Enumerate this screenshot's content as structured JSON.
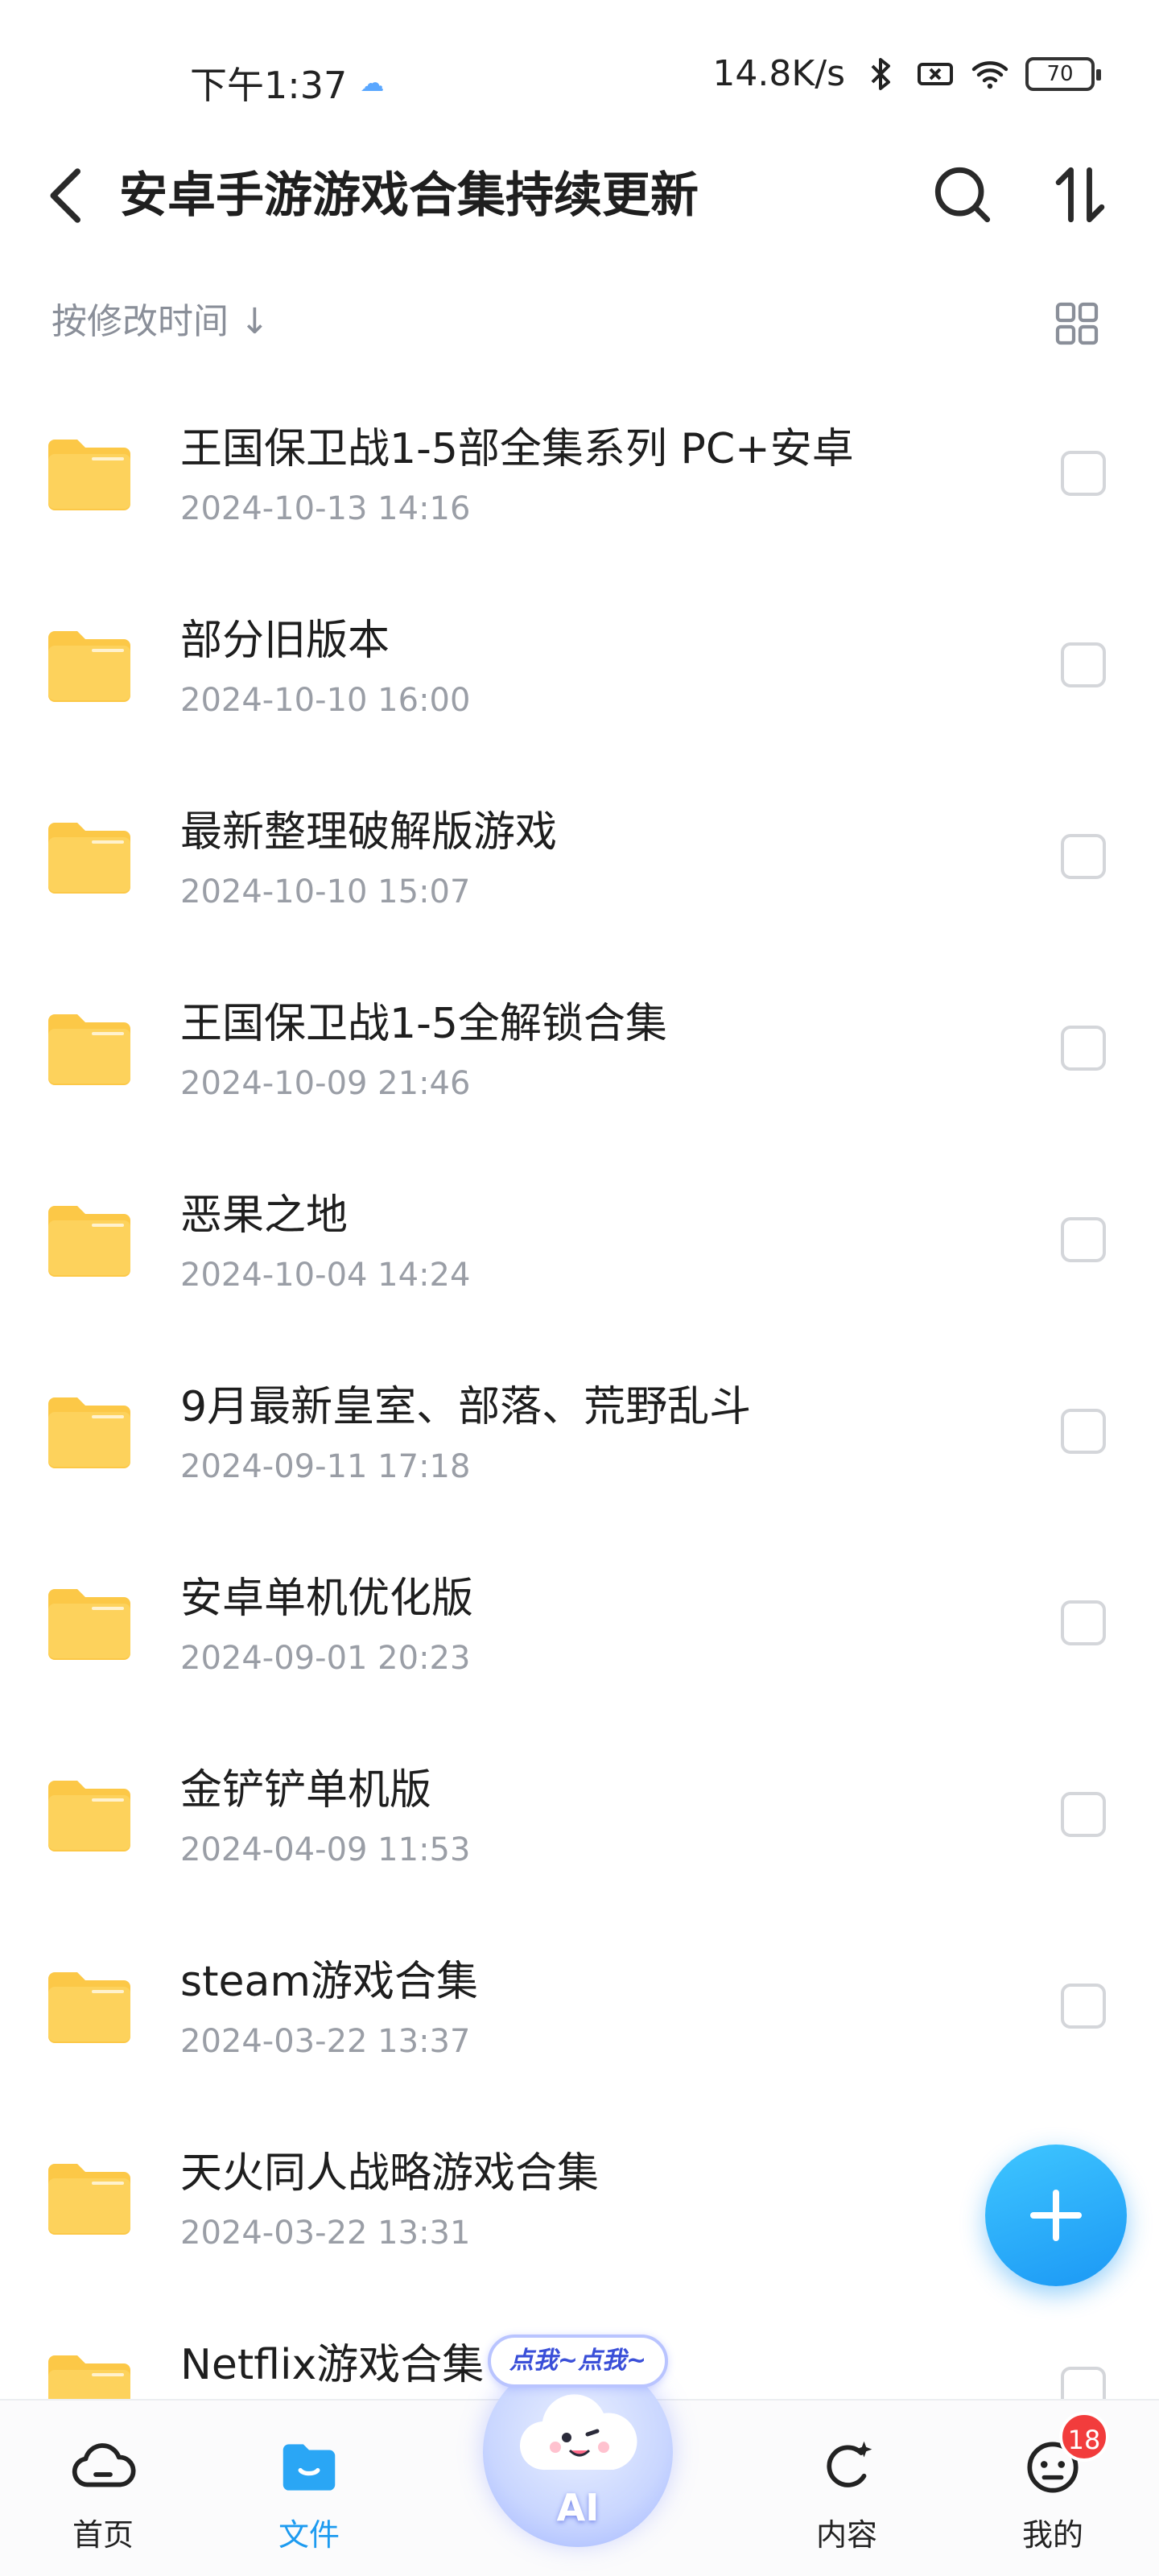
{
  "status_bar": {
    "time": "下午1:37",
    "network_speed": "14.8K/s",
    "battery": "70"
  },
  "header": {
    "title": "安卓手游游戏合集持续更新"
  },
  "sort": {
    "label": "按修改时间 ↓"
  },
  "files": [
    {
      "name": "王国保卫战1-5部全集系列 PC+安卓",
      "date": "2024-10-13 14:16"
    },
    {
      "name": "部分旧版本",
      "date": "2024-10-10 16:00"
    },
    {
      "name": "最新整理破解版游戏",
      "date": "2024-10-10 15:07"
    },
    {
      "name": "王国保卫战1-5全解锁合集",
      "date": "2024-10-09 21:46"
    },
    {
      "name": "恶果之地",
      "date": "2024-10-04 14:24"
    },
    {
      "name": "9月最新皇室、部落、荒野乱斗",
      "date": "2024-09-11 17:18"
    },
    {
      "name": "安卓单机优化版",
      "date": "2024-09-01 20:23"
    },
    {
      "name": "金铲铲单机版",
      "date": "2024-04-09 11:53"
    },
    {
      "name": "steam游戏合集",
      "date": "2024-03-22 13:37"
    },
    {
      "name": "天火同人战略游戏合集",
      "date": "2024-03-22 13:31"
    },
    {
      "name": "Netflix游戏合集",
      "date": ""
    }
  ],
  "ai_tag": "点我~点我~",
  "bottom_nav": {
    "home": "首页",
    "files": "文件",
    "ai": "AI",
    "content": "内容",
    "mine": "我的",
    "mine_badge": "18"
  },
  "colors": {
    "accent": "#1d9bf0",
    "folder": "#fdd25c",
    "badge": "#f23c3c"
  }
}
